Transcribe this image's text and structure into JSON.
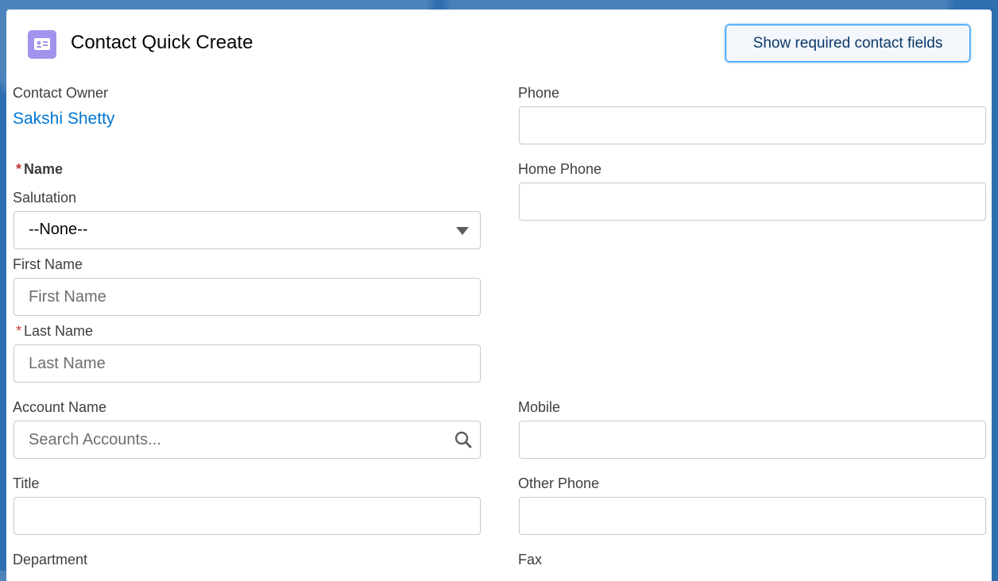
{
  "header": {
    "icon": "contact-card-icon",
    "title": "Contact Quick Create",
    "required_button": "Show required contact fields"
  },
  "fields": {
    "contact_owner": {
      "label": "Contact Owner",
      "value": "Sakshi Shetty"
    },
    "name_section": {
      "label": "Name",
      "required_mark": "*"
    },
    "salutation": {
      "label": "Salutation",
      "value": "--None--"
    },
    "first_name": {
      "label": "First Name",
      "placeholder": "First Name",
      "value": ""
    },
    "last_name": {
      "label": "Last Name",
      "placeholder": "Last Name",
      "required_mark": "*",
      "value": ""
    },
    "account_name": {
      "label": "Account Name",
      "placeholder": "Search Accounts...",
      "value": ""
    },
    "title": {
      "label": "Title",
      "value": ""
    },
    "department": {
      "label": "Department"
    },
    "phone": {
      "label": "Phone",
      "value": ""
    },
    "home_phone": {
      "label": "Home Phone",
      "value": ""
    },
    "mobile": {
      "label": "Mobile",
      "value": ""
    },
    "other_phone": {
      "label": "Other Phone",
      "value": ""
    },
    "fax": {
      "label": "Fax"
    }
  },
  "colors": {
    "accent": "#0176d3",
    "icon_bg": "#a094ed",
    "required": "#c23934",
    "background": "#2f6fb0"
  }
}
